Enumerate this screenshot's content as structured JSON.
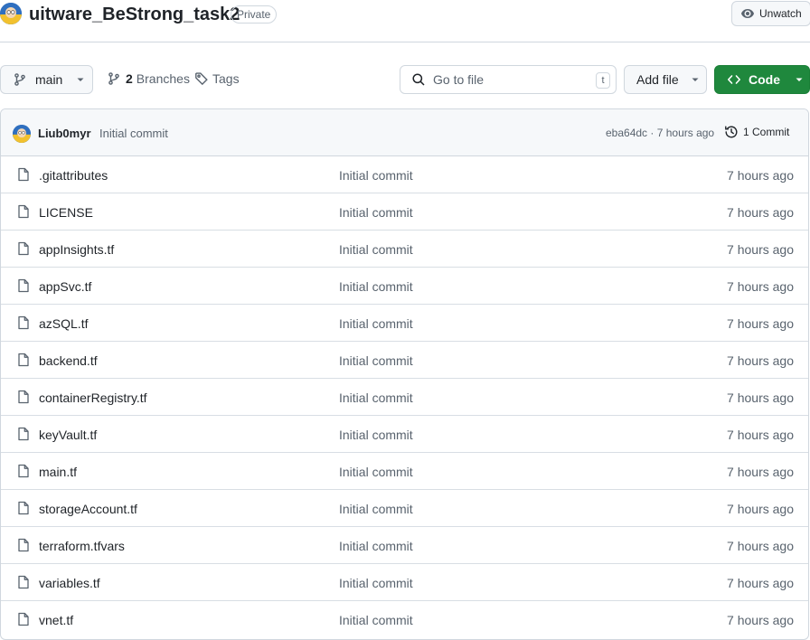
{
  "repo": {
    "name": "uitware_BeStrong_task2",
    "visibility": "Private",
    "watch_label": "Unwatch"
  },
  "toolbar": {
    "branch": "main",
    "branches_count": "2",
    "branches_label": "Branches",
    "tags_label": "Tags",
    "search_placeholder": "Go to file",
    "search_shortcut": "t",
    "add_file_label": "Add file",
    "code_label": "Code"
  },
  "commit": {
    "author": "Liub0myr",
    "message": "Initial commit",
    "meta": "eba64dc · 7 hours ago",
    "count_label": "1 Commit"
  },
  "files": [
    {
      "name": ".gitattributes",
      "message": "Initial commit",
      "time": "7 hours ago"
    },
    {
      "name": "LICENSE",
      "message": "Initial commit",
      "time": "7 hours ago"
    },
    {
      "name": "appInsights.tf",
      "message": "Initial commit",
      "time": "7 hours ago"
    },
    {
      "name": "appSvc.tf",
      "message": "Initial commit",
      "time": "7 hours ago"
    },
    {
      "name": "azSQL.tf",
      "message": "Initial commit",
      "time": "7 hours ago"
    },
    {
      "name": "backend.tf",
      "message": "Initial commit",
      "time": "7 hours ago"
    },
    {
      "name": "containerRegistry.tf",
      "message": "Initial commit",
      "time": "7 hours ago"
    },
    {
      "name": "keyVault.tf",
      "message": "Initial commit",
      "time": "7 hours ago"
    },
    {
      "name": "main.tf",
      "message": "Initial commit",
      "time": "7 hours ago"
    },
    {
      "name": "storageAccount.tf",
      "message": "Initial commit",
      "time": "7 hours ago"
    },
    {
      "name": "terraform.tfvars",
      "message": "Initial commit",
      "time": "7 hours ago"
    },
    {
      "name": "variables.tf",
      "message": "Initial commit",
      "time": "7 hours ago"
    },
    {
      "name": "vnet.tf",
      "message": "Initial commit",
      "time": "7 hours ago"
    }
  ],
  "colors": {
    "code_button": "#1f883d",
    "avatar": "#2f6fbf",
    "border": "#d0d7de"
  }
}
